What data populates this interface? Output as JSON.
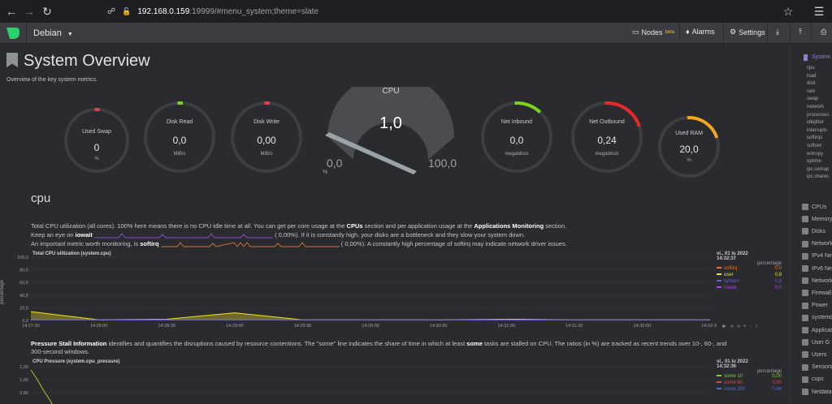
{
  "browser": {
    "url_host": "192.168.0.159",
    "url_rest": ":19999/#menu_system;theme=slate"
  },
  "header": {
    "host_name": "Debian",
    "nodes_label": "Nodes",
    "nodes_badge": "beta",
    "alarms_label": "Alarms",
    "settings_label": "Settings"
  },
  "overview": {
    "title": "System Overview",
    "subtitle": "Overview of the key system metrics."
  },
  "gauges": [
    {
      "label": "Used Swap",
      "value": "0",
      "unit": "%",
      "level": 0,
      "color": "#e84242"
    },
    {
      "label": "Disk Read",
      "value": "0,0",
      "unit": "MiB/s",
      "level": 0,
      "color": "#7ed321"
    },
    {
      "label": "Disk Write",
      "value": "0,00",
      "unit": "MiB/s",
      "level": 0,
      "color": "#e84242"
    },
    {
      "label": "Net Inbound",
      "value": "0,0",
      "unit": "megabits/s",
      "level": 0.12,
      "color": "#7ed321"
    },
    {
      "label": "Net Outbound",
      "value": "0,24",
      "unit": "megabits/s",
      "level": 0.2,
      "color": "#e82828"
    },
    {
      "label": "Used RAM",
      "value": "20,0",
      "unit": "%",
      "level": 0.2,
      "color": "#f5a623"
    }
  ],
  "cpu_gauge": {
    "title": "CPU",
    "value": "1,0",
    "min": "0,0",
    "max": "100,0",
    "unit": "%"
  },
  "cpu_section": {
    "title": "cpu",
    "line1_a": "Total CPU utilization (all cores). 100% here means there is no CPU idle time at all. You can get per core usage at the ",
    "line1_b": "CPUs",
    "line1_c": " section and per application usage at the ",
    "line1_d": "Applications Monitoring",
    "line1_e": " section.",
    "line2_a": "Keep an eye on ",
    "line2_b": "iowait",
    "line2_c": " ( 0,00%). If it is constantly high, your disks are a bottleneck and they slow your system down.",
    "line3_a": "An important metric worth monitoring, is ",
    "line3_b": "softirq",
    "line3_c": " ( 0,00%). A constantly high percentage of softirq may indicate network driver issues."
  },
  "cpu_chart": {
    "title": "Total CPU utilization (system.cpu)",
    "ylabel": "percentage",
    "legend_date": "vi., 01 lu 2022",
    "legend_time": "14:32:37",
    "legend_unit": "percentage",
    "legend": [
      {
        "name": "softirq",
        "value": "0,0",
        "color": "#e8732a"
      },
      {
        "name": "user",
        "value": "0,8",
        "color": "#f0e020"
      },
      {
        "name": "system",
        "value": "0,3",
        "color": "#6a5fd8"
      },
      {
        "name": "iowait",
        "value": "0,0",
        "color": "#b040e0"
      }
    ]
  },
  "chart_data": {
    "type": "area",
    "title": "Total CPU utilization (system.cpu)",
    "ylabel": "percentage",
    "x": [
      "14:27:30",
      "14:28:00",
      "14:28:30",
      "14:29:00",
      "14:29:30",
      "14:30:00",
      "14:30:30",
      "14:31:00",
      "14:31:30",
      "14:32:00",
      "14:32:30"
    ],
    "yticks": [
      "100,0",
      "80,0",
      "60,0",
      "40,0",
      "20,0",
      "0,0"
    ],
    "ylim": [
      0,
      100
    ],
    "series": [
      {
        "name": "user",
        "values": [
          14,
          1,
          2,
          12,
          1,
          1,
          1,
          2,
          1,
          1,
          1
        ]
      },
      {
        "name": "system",
        "values": [
          2,
          1,
          1,
          2,
          1,
          1,
          1,
          1,
          1,
          1,
          1
        ]
      }
    ]
  },
  "pressure_section": {
    "text_a": "Pressure Stall Information",
    "text_b": " identifies and quantifies the disruptions caused by resource contentions. The \"some\" line indicates the share of time in which at least ",
    "text_c": "some",
    "text_d": " tasks are stalled on CPU. The ratios (in %) are tracked as recent trends over 10-, 60-, and",
    "text_e": "300-second windows."
  },
  "pressure_chart": {
    "title": "CPU Pressure (system.cpu_pressure)",
    "legend_date": "vi., 01 lu 2022",
    "legend_time": "14:32:36",
    "legend_unit": "percentage",
    "yticks": [
      "1,20",
      "1,00",
      "0,80"
    ],
    "legend": [
      {
        "name": "some 10",
        "value": "0,00",
        "color": "#7ed321"
      },
      {
        "name": "some 60",
        "value": "0,00",
        "color": "#e84242"
      },
      {
        "name": "some 300",
        "value": "0,64",
        "color": "#4a6fe0"
      }
    ]
  },
  "sidebar": {
    "active": "System",
    "subitems": [
      "cpu",
      "load",
      "disk",
      "ram",
      "swap",
      "network",
      "processes",
      "idlejitter",
      "interrupts",
      "softirqs",
      "softnet",
      "entropy",
      "uptime",
      "ipc.semap",
      "ipc.sharec"
    ],
    "items": [
      "CPUs",
      "Memory",
      "Disks",
      "Network",
      "IPv4 Ne",
      "IPv6 Ne",
      "Network",
      "Firewall",
      "Power",
      "systemd",
      "Applicati",
      "User G",
      "Users",
      "Sensors",
      "cups",
      "Netdata"
    ]
  }
}
